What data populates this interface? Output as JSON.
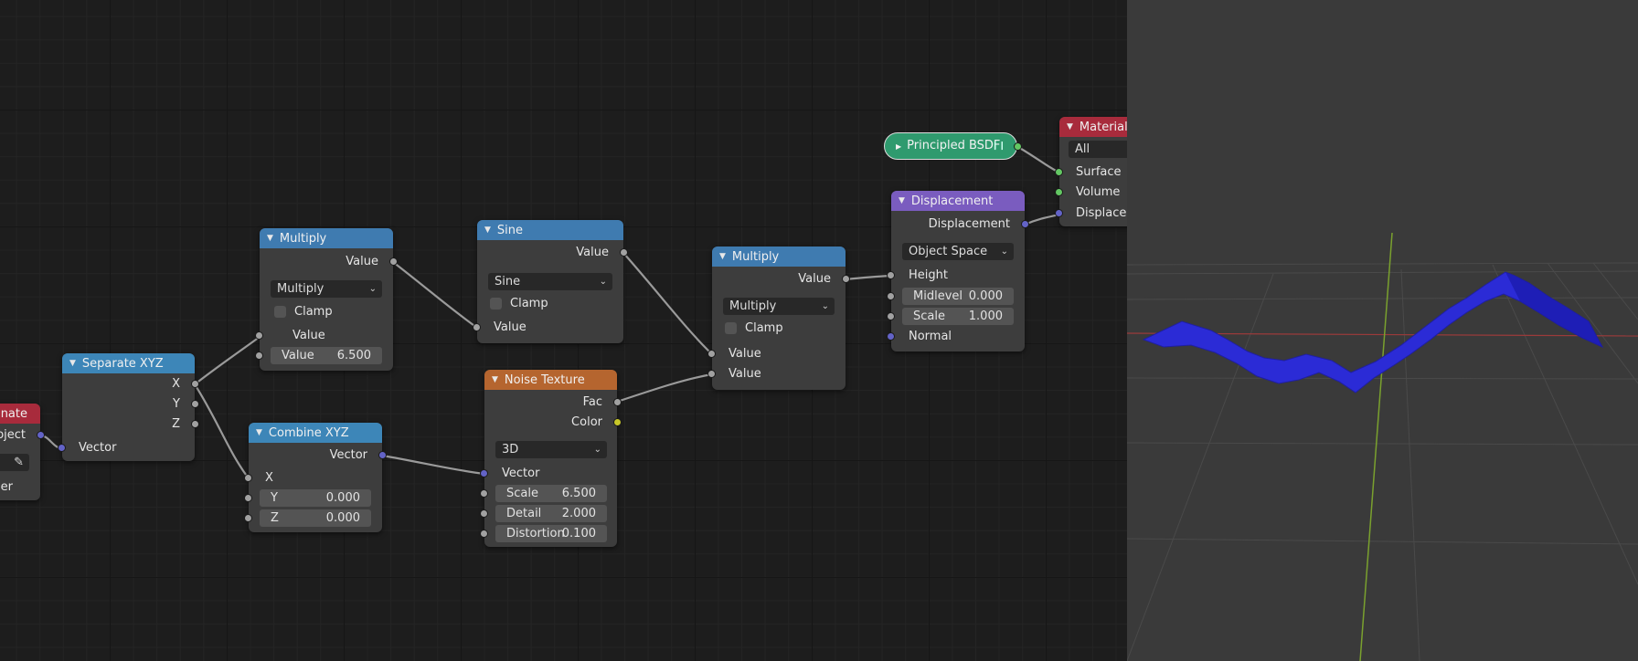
{
  "node_editor": {
    "coordinate_node": {
      "title": "dinate",
      "output": "Object",
      "output_short": "oject",
      "extra": "cer"
    },
    "separate_xyz": {
      "title": "Separate XYZ",
      "outputs": [
        "X",
        "Y",
        "Z"
      ],
      "input": "Vector"
    },
    "multiply1": {
      "title": "Multiply",
      "output": "Value",
      "operation": "Multiply",
      "clamp": "Clamp",
      "input1": "Value",
      "input2_label": "Value",
      "input2_value": "6.500"
    },
    "combine_xyz": {
      "title": "Combine XYZ",
      "output": "Vector",
      "x": "X",
      "y_label": "Y",
      "y_value": "0.000",
      "z_label": "Z",
      "z_value": "0.000"
    },
    "sine": {
      "title": "Sine",
      "output": "Value",
      "operation": "Sine",
      "clamp": "Clamp",
      "input": "Value"
    },
    "noise": {
      "title": "Noise Texture",
      "out_fac": "Fac",
      "out_color": "Color",
      "dimensions": "3D",
      "vector": "Vector",
      "scale_label": "Scale",
      "scale_value": "6.500",
      "detail_label": "Detail",
      "detail_value": "2.000",
      "distortion_label": "Distortion",
      "distortion_value": "0.100"
    },
    "multiply2": {
      "title": "Multiply",
      "output": "Value",
      "operation": "Multiply",
      "clamp": "Clamp",
      "input1": "Value",
      "input2": "Value"
    },
    "displacement": {
      "title": "Displacement",
      "output": "Displacement",
      "space": "Object Space",
      "height": "Height",
      "midlevel_label": "Midlevel",
      "midlevel_value": "0.000",
      "scale_label": "Scale",
      "scale_value": "1.000",
      "normal": "Normal"
    },
    "bsdf": {
      "title": "Principled BSDF"
    },
    "material_output": {
      "title": "Material",
      "target": "All",
      "surface": "Surface",
      "volume": "Volume",
      "displacement": "Displacer"
    }
  },
  "colors": {
    "float_socket": "#a1a1a1",
    "vector_socket": "#6363c7",
    "color_socket": "#c7c729",
    "shader_socket": "#63c763",
    "mesh": "#2b2bd6"
  }
}
